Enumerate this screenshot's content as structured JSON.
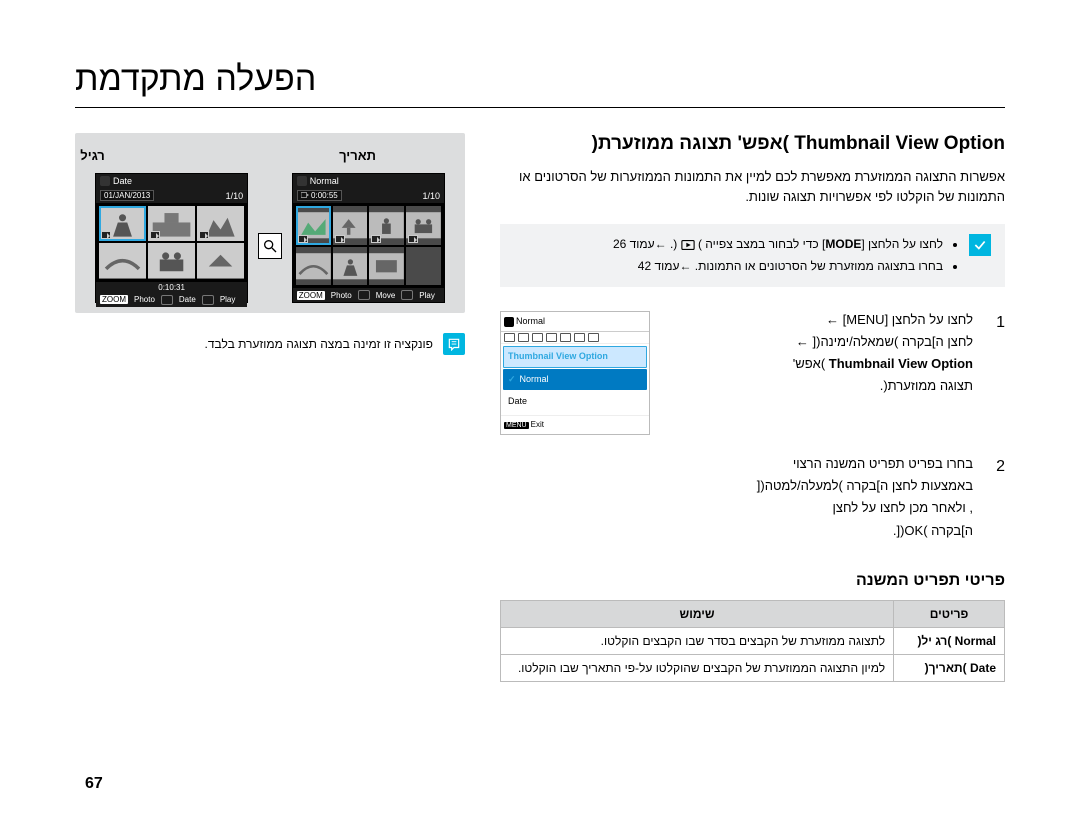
{
  "page": {
    "title": "הפעלה מתקדמת",
    "number": "67"
  },
  "section": {
    "heading": "Thumbnail View Option )אפש' תצוגה ממוזערת(",
    "desc": "אפשרות התצוגה הממוזערת מאפשרת לכם למיין את התמונות הממוזערות של הסרטונים או התמונות של הוקלטו לפי אפשרויות תצוגה שונות."
  },
  "tips": {
    "line1_pre": "לחצו על הלחצן [",
    "line1_mode": "MODE",
    "line1_mid": "] כדי לבחור במצב צפייה ) ",
    "line1_post": "(. ←עמוד 26",
    "line2": "בחרו בתצוגה ממוזערת של הסרטונים או התמונות. ←עמוד 42"
  },
  "steps": {
    "s1": {
      "num": "1",
      "l1": "לחצו על הלחצן [MENU] ←",
      "l2": "לחצן ה]בקרה )שמאלה/ימינה([ ←",
      "l3_strong": "Thumbnail View Option",
      "l3_rest": " )אפש'",
      "l4": "תצוגה ממוזערת(."
    },
    "s2": {
      "num": "2",
      "l1": "בחרו בפריט תפריט המשנה הרצוי",
      "l2": "באמצעות לחצן ה]בקרה )למעלה/למטה([",
      "l3": ", ולאחר מכן לחצו על לחצן",
      "l4": "ה]בקרה )OK([."
    }
  },
  "mini": {
    "top_label": "Normal",
    "tab": "Thumbnail View Option",
    "opt1": "Normal",
    "opt2": "Date",
    "exit_tag": "MENU",
    "exit": "Exit"
  },
  "submenu": {
    "heading": "פריטי תפריט המשנה",
    "th_items": "פריטים",
    "th_use": "שימוש",
    "r1_item": "Normal )רג יל(",
    "r1_use": "לתצוגה ממוזערת של הקבצים בסדר שבו הקבצים הוקלטו.",
    "r2_item": "Date )תאריך(",
    "r2_use": "למיון התצוגה הממוזערת של הקבצים שהוקלטו על-פי התאריך שבו הוקלטו."
  },
  "preview": {
    "cap_date": "תאריך",
    "cap_normal": "רגיל",
    "lcd1": {
      "top_word": "Date",
      "date_label": "01/JAN/2013",
      "count": "1/10",
      "timecode": "0:10:31",
      "foot_zoom": "ZOOM",
      "foot_l1": "Photo",
      "foot_l2": "Date",
      "foot_l3": "Play"
    },
    "lcd2": {
      "top_word": "Normal",
      "time_label": "0:00:55",
      "count": "1/10",
      "foot_zoom": "ZOOM",
      "foot_l1": "Photo",
      "foot_l2": "Move",
      "foot_l3": "Play"
    }
  },
  "note": "פונקציה זו זמינה במצה תצוגה ממוזערת בלבד."
}
